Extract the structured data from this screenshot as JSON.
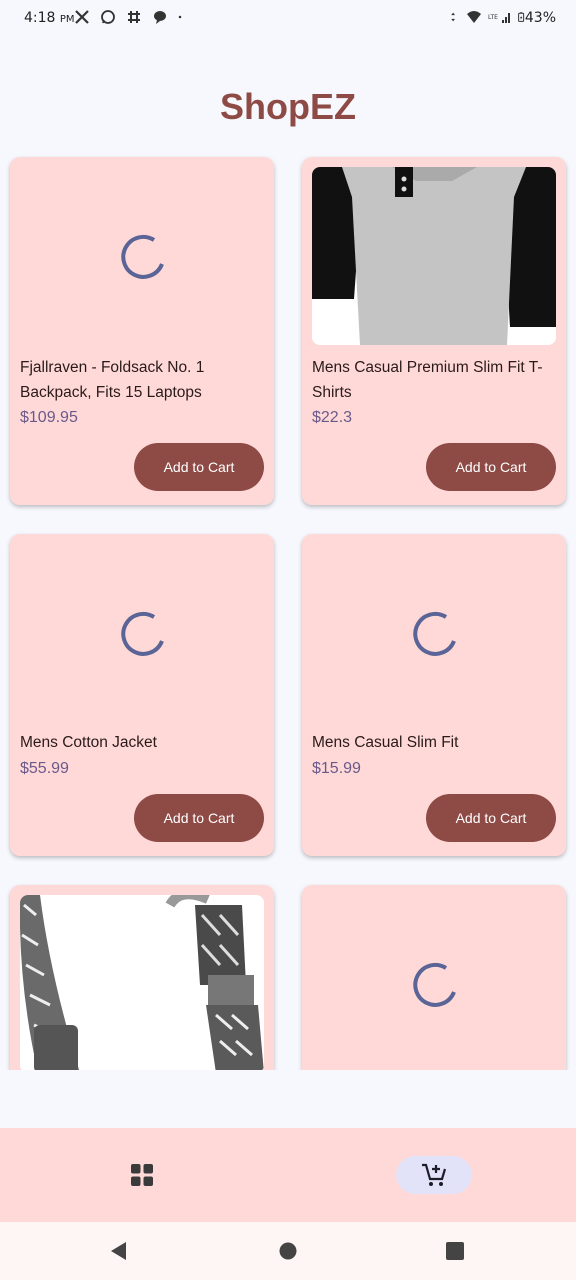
{
  "status_bar": {
    "time": "4:18",
    "ampm": "PM",
    "battery": "43%",
    "icons_left": [
      "x-icon",
      "whatsapp-icon",
      "slack-icon",
      "chat-icon",
      "dot-icon"
    ],
    "icons_right": [
      "data-arrows-icon",
      "wifi-icon",
      "lte-signal-icon",
      "battery-icon"
    ]
  },
  "app": {
    "title": "ShopEZ"
  },
  "products": [
    {
      "name": "Fjallraven - Foldsack No. 1 Backpack, Fits 15 Laptops",
      "price": "$109.95",
      "button": "Add to Cart",
      "image": "loading"
    },
    {
      "name": "Mens Casual Premium Slim Fit T-Shirts",
      "price": "$22.3",
      "button": "Add to Cart",
      "image": "tshirt"
    },
    {
      "name": "Mens Cotton Jacket",
      "price": "$55.99",
      "button": "Add to Cart",
      "image": "loading"
    },
    {
      "name": "Mens Casual Slim Fit",
      "price": "$15.99",
      "button": "Add to Cart",
      "image": "loading"
    },
    {
      "name": "",
      "price": "",
      "button": "",
      "image": "bracelet"
    },
    {
      "name": "",
      "price": "",
      "button": "",
      "image": "loading"
    }
  ],
  "bottom_nav": {
    "items": [
      {
        "icon": "grid-icon",
        "selected": false
      },
      {
        "icon": "cart-add-icon",
        "selected": true
      }
    ]
  },
  "system_nav": [
    "back-icon",
    "home-icon",
    "recents-icon"
  ],
  "colors": {
    "background": "#f7f8fe",
    "card": "#ffd9d8",
    "accent": "#8e4a45",
    "price": "#6a5a8a",
    "spinner": "#5a6496",
    "nav_selected": "#e2e2f8"
  }
}
